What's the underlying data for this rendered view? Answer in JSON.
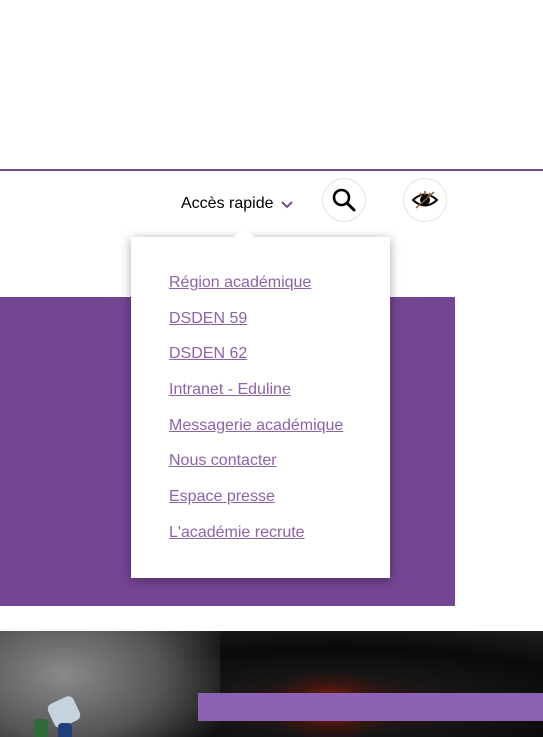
{
  "header": {
    "quick_access_label": "Accès rapide",
    "icons": {
      "chevron": "chevron-down-icon",
      "search": "search-icon",
      "accessibility": "eye-icon"
    }
  },
  "dropdown": {
    "items": [
      {
        "label": "Région académique"
      },
      {
        "label": "DSDEN 59"
      },
      {
        "label": "DSDEN 62"
      },
      {
        "label": "Intranet - Eduline"
      },
      {
        "label": "Messagerie académique"
      },
      {
        "label": "Nous contacter"
      },
      {
        "label": "Espace presse"
      },
      {
        "label": "L'académie recrute"
      }
    ]
  },
  "colors": {
    "brand_purple": "#744592",
    "link_purple": "#8e62a8",
    "divider": "#7a4a8c",
    "bar_purple": "#8d62b4"
  }
}
